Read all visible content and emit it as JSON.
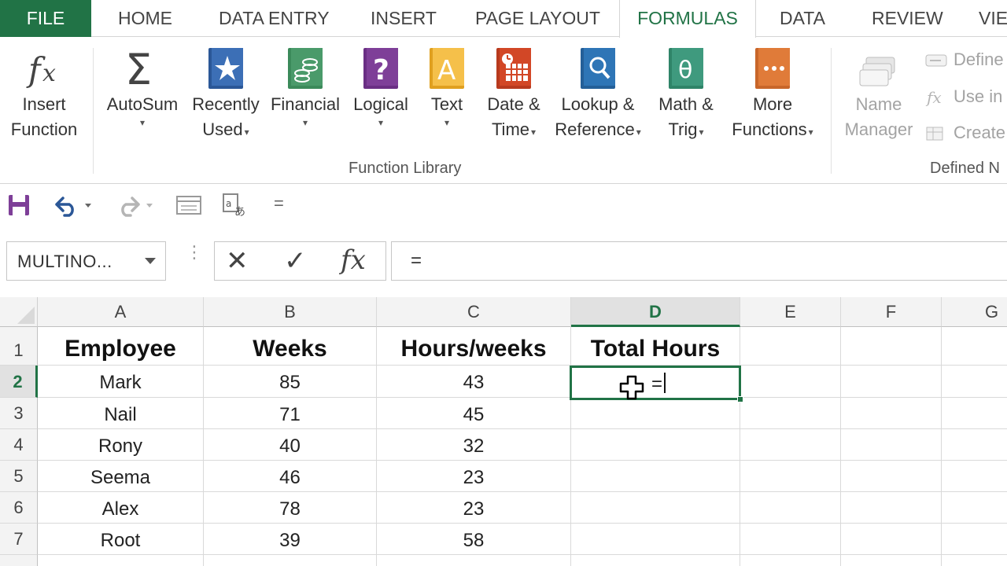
{
  "tabs": {
    "file": "FILE",
    "home": "HOME",
    "data_entry": "DATA ENTRY",
    "insert": "INSERT",
    "page_layout": "PAGE LAYOUT",
    "formulas": "FORMULAS",
    "data": "DATA",
    "review": "REVIEW",
    "view": "VIE"
  },
  "ribbon": {
    "insert_function": [
      "Insert",
      "Function"
    ],
    "autosum": "AutoSum",
    "recently_used": [
      "Recently",
      "Used"
    ],
    "financial": "Financial",
    "logical": "Logical",
    "text": "Text",
    "date_time": [
      "Date &",
      "Time"
    ],
    "lookup_reference": [
      "Lookup &",
      "Reference"
    ],
    "math_trig": [
      "Math &",
      "Trig"
    ],
    "more_functions": [
      "More",
      "Functions"
    ],
    "group_function_library": "Function Library",
    "name_manager": [
      "Name",
      "Manager"
    ],
    "define_name": "Define",
    "use_in_formula": "Use in",
    "create_from_selection": "Create",
    "group_defined_names": "Defined N",
    "dropdown_glyph": "▾"
  },
  "qat": {
    "more_glyph": "="
  },
  "formula_bar": {
    "name_box": "MULTINO...",
    "cancel_glyph": "✕",
    "enter_glyph": "✓",
    "fx_glyph": "fx",
    "content": "="
  },
  "grid": {
    "columns": [
      "A",
      "B",
      "C",
      "D",
      "E",
      "F",
      "G"
    ],
    "selected_column": "D",
    "rows": [
      "1",
      "2",
      "3",
      "4",
      "5",
      "6",
      "7"
    ],
    "selected_row": "2",
    "header_row": [
      "Employee",
      "Weeks",
      "Hours/weeks",
      "Total Hours"
    ],
    "data": [
      [
        "Mark",
        "85",
        "43"
      ],
      [
        "Nail",
        "71",
        "45"
      ],
      [
        "Rony",
        "40",
        "32"
      ],
      [
        "Seema",
        "46",
        "23"
      ],
      [
        "Alex",
        "78",
        "23"
      ],
      [
        "Root",
        "39",
        "58"
      ]
    ],
    "active_cell": "D2",
    "active_cell_entry": "="
  },
  "colors": {
    "accent_green": "#217346",
    "financial_green": "#4a9a6a",
    "logical_purple": "#7e3f98",
    "text_yellow": "#f0b429",
    "date_red": "#d24726",
    "lookup_blue": "#2e75b6",
    "math_teal": "#3f9a7e",
    "more_orange": "#e07b39",
    "recently_blue": "#2b5797"
  }
}
